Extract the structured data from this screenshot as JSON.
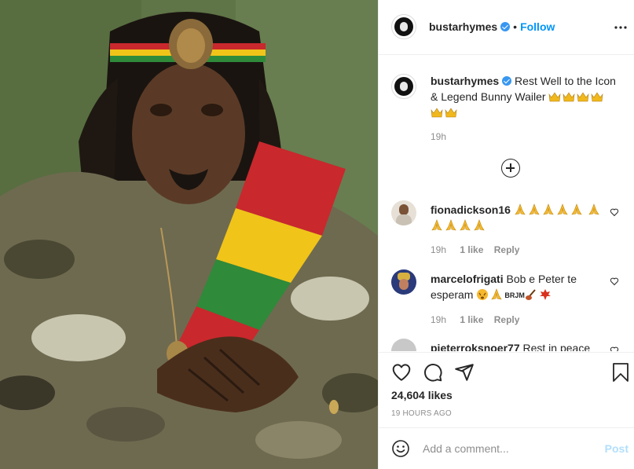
{
  "post": {
    "author": "bustarhymes",
    "follow_label": "Follow",
    "separator": "•",
    "caption": "Rest Well to the Icon & Legend Bunny Wailer",
    "caption_time": "19h",
    "likes": "24,604 likes",
    "time_ago": "19 HOURS AGO"
  },
  "comments": [
    {
      "user": "fionadickson16",
      "text": "",
      "time": "19h",
      "likes": "1 like",
      "reply": "Reply"
    },
    {
      "user": "marcelofrigati",
      "text": "Bob e Peter te esperam",
      "emoji_text": "BRJM",
      "time": "19h",
      "likes": "1 like",
      "reply": "Reply"
    },
    {
      "user": "pieterroksnoer77",
      "text": "Rest in peace"
    }
  ],
  "add_comment": {
    "placeholder": "Add a comment...",
    "post_label": "Post"
  },
  "icons": {
    "header": [
      "verified-badge-icon",
      "more-options-icon"
    ],
    "actions": [
      "heart-icon",
      "comment-icon",
      "share-icon",
      "bookmark-icon",
      "emoji-icon",
      "add-comment-plus-icon"
    ]
  },
  "colors": {
    "accent": "#0095f6",
    "verified": "#3897f0",
    "muted": "#8e8e8e",
    "border": "#efefef"
  }
}
